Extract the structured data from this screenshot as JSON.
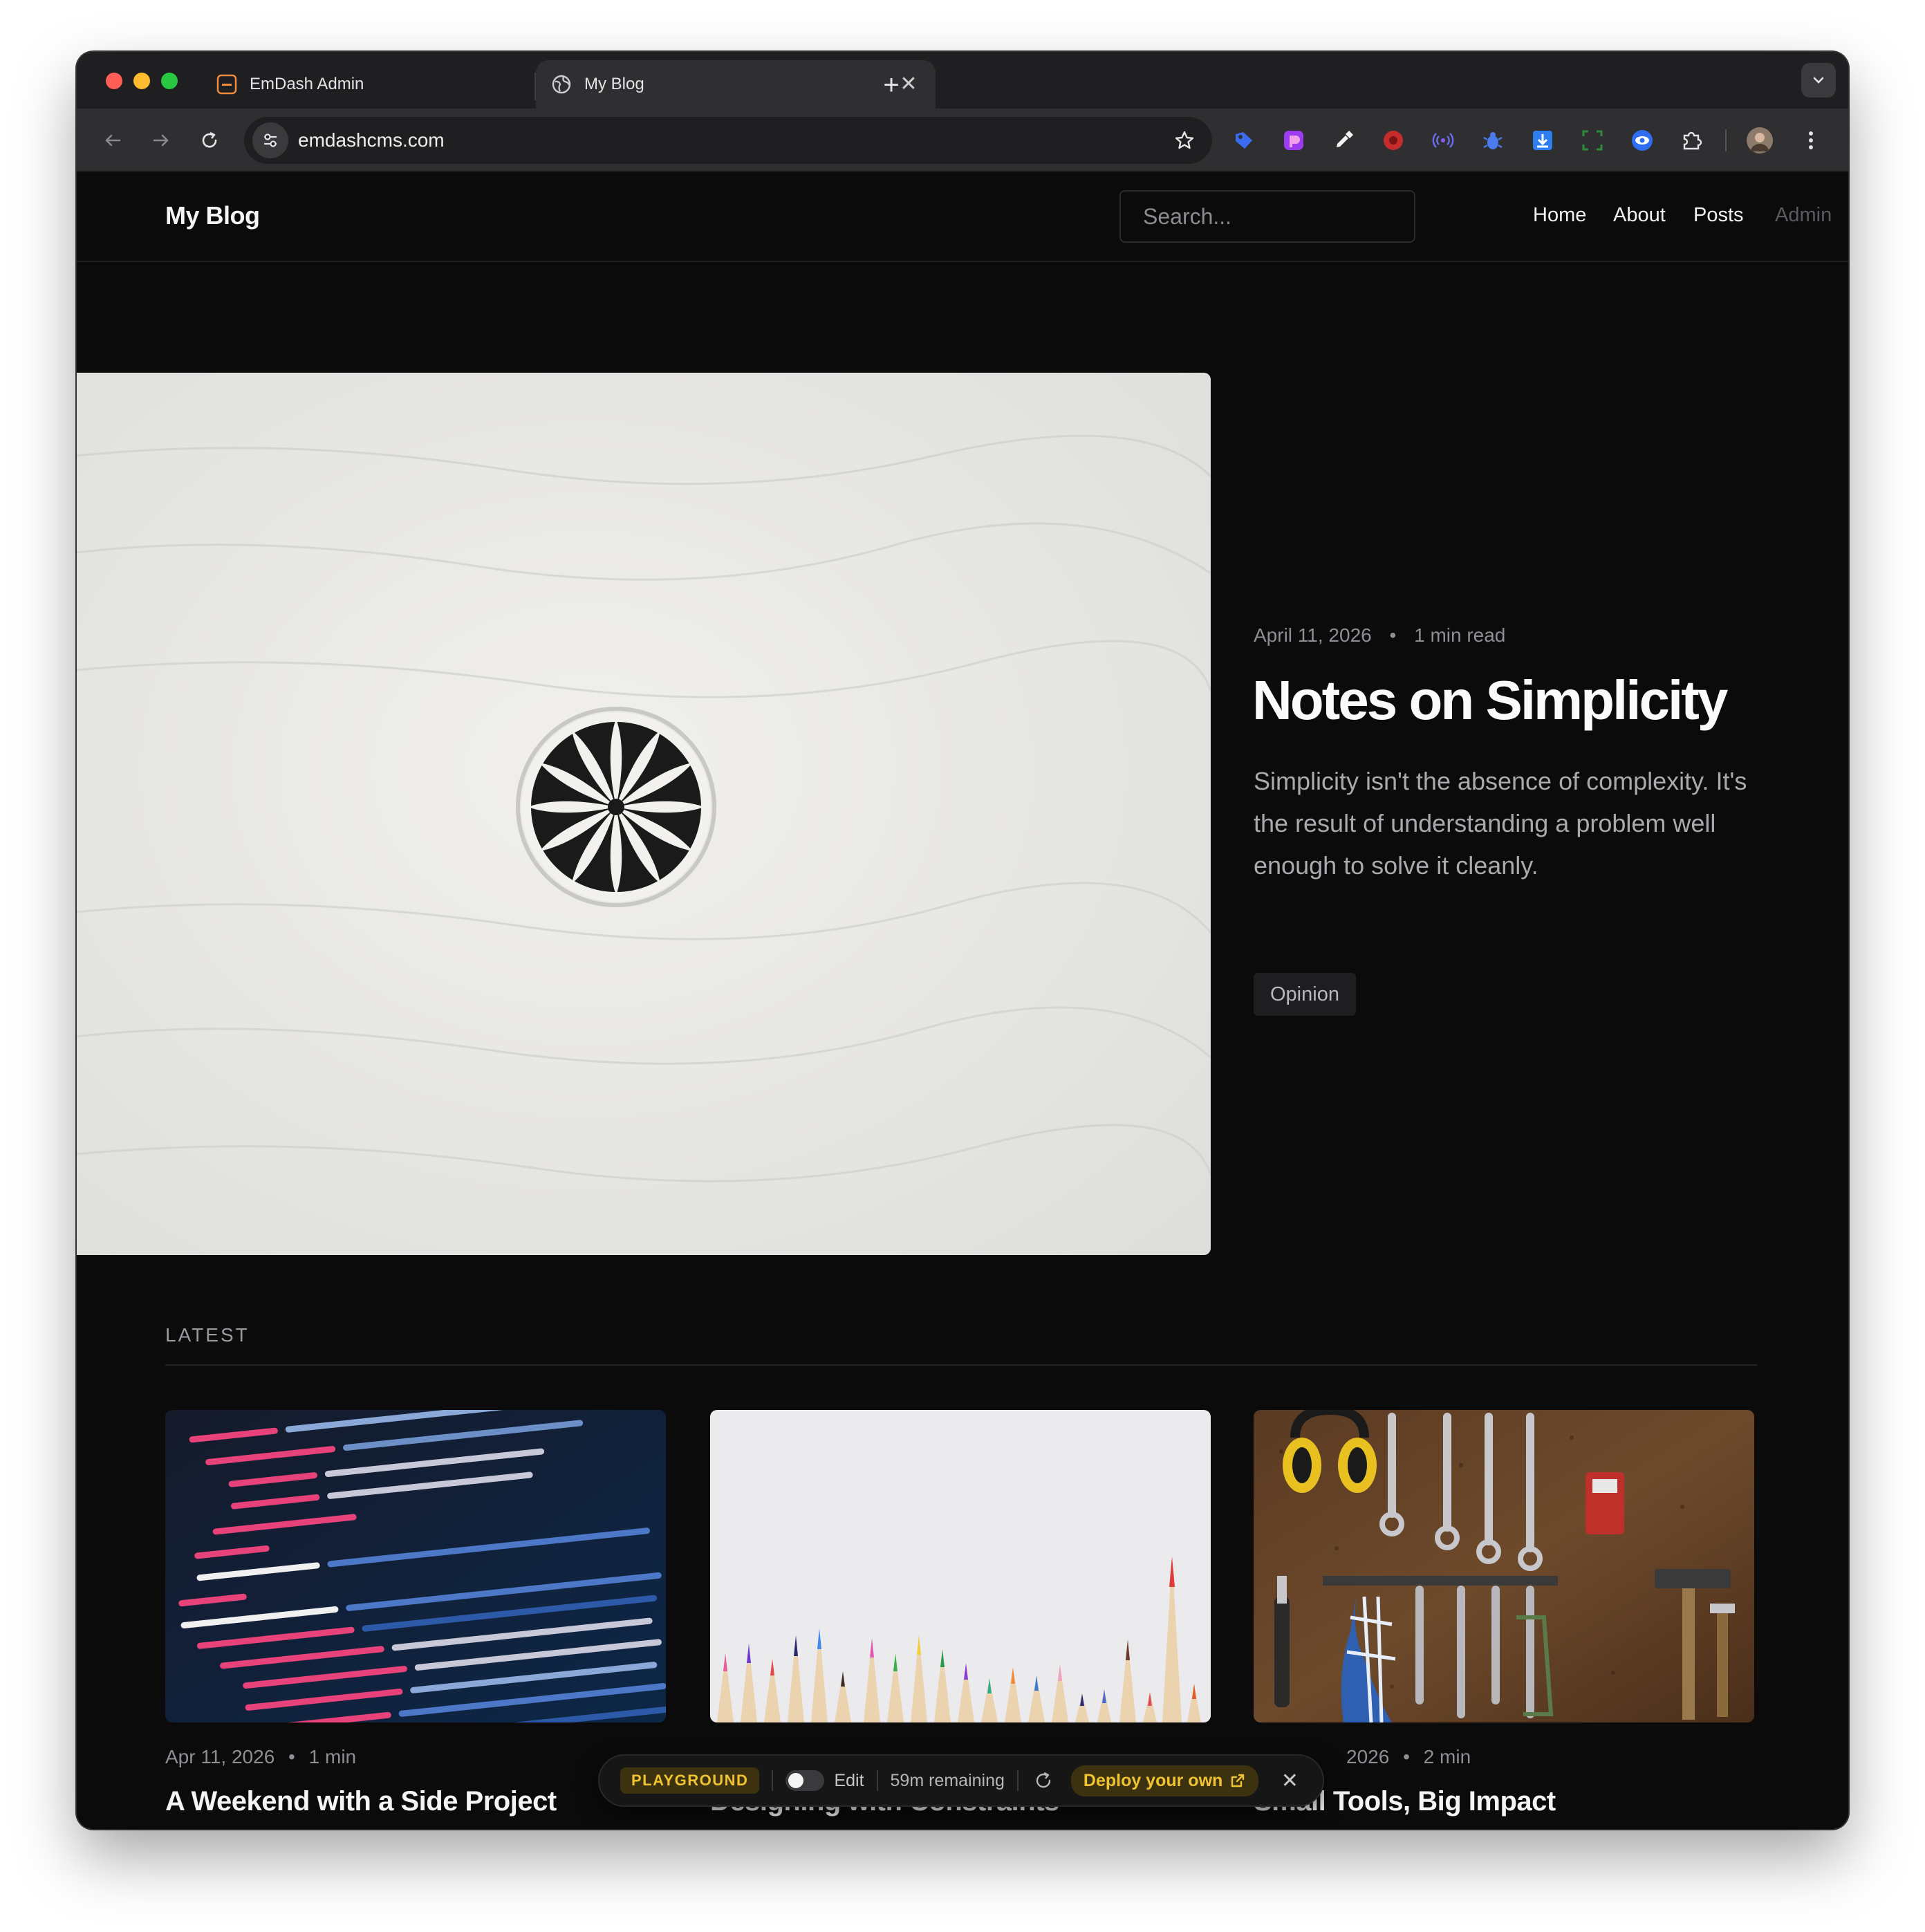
{
  "browser": {
    "tabs": [
      {
        "title": "EmDash Admin",
        "icon": "emdash-logo-icon",
        "active": false
      },
      {
        "title": "My Blog",
        "icon": "globe-icon",
        "active": true
      }
    ],
    "new_tab_label": "+",
    "close_glyph": "✕",
    "url": "emdashcms.com",
    "extensions": [
      "tag-extension-icon",
      "purple-app-icon",
      "eyedropper-icon",
      "red-record-icon",
      "radio-waves-icon",
      "bug-icon",
      "download-arrow-icon",
      "screenshot-frame-icon",
      "eye-icon",
      "puzzle-piece-icon",
      "profile-avatar"
    ]
  },
  "site": {
    "brand": "My Blog",
    "search_placeholder": "Search...",
    "nav": {
      "home": "Home",
      "about": "About",
      "posts": "Posts",
      "admin": "Admin"
    }
  },
  "featured": {
    "date": "April 11, 2026",
    "separator": "•",
    "read_time": "1 min read",
    "title": "Notes on Simplicity",
    "excerpt": "Simplicity isn't the absence of complexity. It's the result of understanding a problem well enough to solve it cleanly.",
    "tag": "Opinion",
    "image": "white-textured-wall-with-floral-vent-image"
  },
  "latest": {
    "label": "LATEST",
    "posts": [
      {
        "date": "Apr 11, 2026",
        "separator": "•",
        "read_time": "1 min",
        "title": "A Weekend with a Side Project",
        "image": "code-on-screen-image"
      },
      {
        "date": "",
        "separator": "",
        "read_time": "",
        "title": "Designing with Constraints",
        "image": "colored-pencils-image"
      },
      {
        "date": "2026",
        "separator": "•",
        "read_time": "2 min",
        "title": "Small Tools, Big Impact",
        "image": "tool-wall-image"
      }
    ]
  },
  "playground": {
    "badge": "PLAYGROUND",
    "edit_label": "Edit",
    "edit_enabled": false,
    "remaining": "59m remaining",
    "deploy_label": "Deploy your own",
    "close_glyph": "✕"
  },
  "colors": {
    "page_bg": "#0b0b0c",
    "accent_gold": "#f0c332",
    "muted_text": "#8e8e94"
  }
}
